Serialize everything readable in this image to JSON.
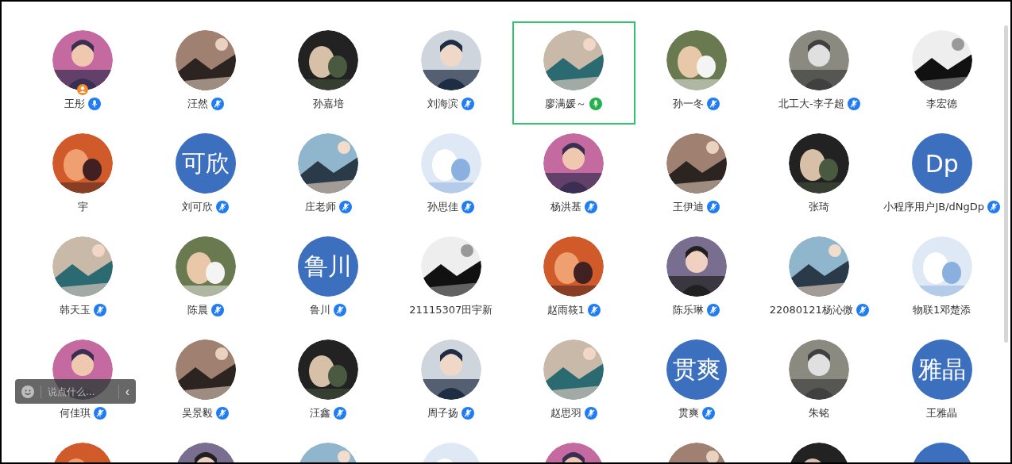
{
  "people": [
    {
      "name": "王彤",
      "avatar": {
        "kind": "picture"
      },
      "mic": {
        "muted": false,
        "speaking": false
      },
      "host": true,
      "selected": false
    },
    {
      "name": "汪然",
      "avatar": {
        "kind": "picture"
      },
      "mic": {
        "muted": true,
        "speaking": false
      },
      "host": false,
      "selected": false
    },
    {
      "name": "孙嘉培",
      "avatar": {
        "kind": "picture"
      },
      "host": false,
      "selected": false
    },
    {
      "name": "刘海滨",
      "avatar": {
        "kind": "picture"
      },
      "mic": {
        "muted": true,
        "speaking": false
      },
      "host": false,
      "selected": false
    },
    {
      "name": "廖满媛～",
      "avatar": {
        "kind": "picture"
      },
      "mic": {
        "muted": false,
        "speaking": true
      },
      "host": false,
      "selected": true
    },
    {
      "name": "孙一冬",
      "avatar": {
        "kind": "picture"
      },
      "mic": {
        "muted": true,
        "speaking": false
      },
      "host": false,
      "selected": false
    },
    {
      "name": "北工大-李子超",
      "avatar": {
        "kind": "picture"
      },
      "mic": {
        "muted": true,
        "speaking": false
      },
      "host": false,
      "selected": false
    },
    {
      "name": "李宏德",
      "avatar": {
        "kind": "picture"
      },
      "host": false,
      "selected": false
    },
    {
      "name": "宇",
      "avatar": {
        "kind": "picture"
      },
      "host": false,
      "selected": false
    },
    {
      "name": "刘可欣",
      "avatar": {
        "kind": "text",
        "text": "可欣"
      },
      "mic": {
        "muted": true,
        "speaking": false
      },
      "host": false,
      "selected": false
    },
    {
      "name": "庄老师",
      "avatar": {
        "kind": "picture"
      },
      "mic": {
        "muted": true,
        "speaking": false
      },
      "host": false,
      "selected": false
    },
    {
      "name": "孙思佳",
      "avatar": {
        "kind": "picture"
      },
      "mic": {
        "muted": true,
        "speaking": false
      },
      "host": false,
      "selected": false
    },
    {
      "name": "杨洪基",
      "avatar": {
        "kind": "picture"
      },
      "mic": {
        "muted": true,
        "speaking": false
      },
      "host": false,
      "selected": false
    },
    {
      "name": "王伊迪",
      "avatar": {
        "kind": "picture"
      },
      "mic": {
        "muted": true,
        "speaking": false
      },
      "host": false,
      "selected": false
    },
    {
      "name": "张琦",
      "avatar": {
        "kind": "picture"
      },
      "host": false,
      "selected": false
    },
    {
      "name": "小程序用户JB/dNgDp",
      "avatar": {
        "kind": "text",
        "text": "Dp"
      },
      "mic": {
        "muted": true,
        "speaking": false
      },
      "host": false,
      "selected": false
    },
    {
      "name": "韩天玉",
      "avatar": {
        "kind": "picture"
      },
      "mic": {
        "muted": true,
        "speaking": false
      },
      "host": false,
      "selected": false
    },
    {
      "name": "陈晨",
      "avatar": {
        "kind": "picture"
      },
      "mic": {
        "muted": true,
        "speaking": false
      },
      "host": false,
      "selected": false
    },
    {
      "name": "鲁川",
      "avatar": {
        "kind": "text",
        "text": "鲁川"
      },
      "mic": {
        "muted": true,
        "speaking": false
      },
      "host": false,
      "selected": false
    },
    {
      "name": "21115307田宇新",
      "avatar": {
        "kind": "picture"
      },
      "host": false,
      "selected": false
    },
    {
      "name": "赵雨筱1",
      "avatar": {
        "kind": "picture"
      },
      "mic": {
        "muted": true,
        "speaking": false
      },
      "host": false,
      "selected": false
    },
    {
      "name": "陈乐琳",
      "avatar": {
        "kind": "picture"
      },
      "mic": {
        "muted": true,
        "speaking": false
      },
      "host": false,
      "selected": false
    },
    {
      "name": "22080121杨沁微",
      "avatar": {
        "kind": "picture"
      },
      "mic": {
        "muted": true,
        "speaking": false
      },
      "host": false,
      "selected": false
    },
    {
      "name": "物联1邓楚添",
      "avatar": {
        "kind": "picture"
      },
      "host": false,
      "selected": false
    },
    {
      "name": "何佳琪",
      "avatar": {
        "kind": "picture"
      },
      "mic": {
        "muted": true,
        "speaking": false
      },
      "host": false,
      "selected": false
    },
    {
      "name": "吴景毅",
      "avatar": {
        "kind": "picture"
      },
      "mic": {
        "muted": true,
        "speaking": false
      },
      "host": false,
      "selected": false
    },
    {
      "name": "汪鑫",
      "avatar": {
        "kind": "picture"
      },
      "mic": {
        "muted": true,
        "speaking": false
      },
      "host": false,
      "selected": false
    },
    {
      "name": "周子扬",
      "avatar": {
        "kind": "picture"
      },
      "mic": {
        "muted": true,
        "speaking": false
      },
      "host": false,
      "selected": false
    },
    {
      "name": "赵思羽",
      "avatar": {
        "kind": "picture"
      },
      "mic": {
        "muted": true,
        "speaking": false
      },
      "host": false,
      "selected": false
    },
    {
      "name": "贯爽",
      "avatar": {
        "kind": "text",
        "text": "贯爽"
      },
      "mic": {
        "muted": true,
        "speaking": false
      },
      "host": false,
      "selected": false
    },
    {
      "name": "朱铭",
      "avatar": {
        "kind": "picture"
      },
      "host": false,
      "selected": false
    },
    {
      "name": "王雅晶",
      "avatar": {
        "kind": "text",
        "text": "雅晶"
      },
      "host": false,
      "selected": false
    },
    {
      "avatar": {
        "kind": "picture"
      }
    },
    {
      "avatar": {
        "kind": "picture"
      }
    },
    {
      "avatar": {
        "kind": "picture"
      }
    },
    {
      "avatar": {
        "kind": "picture"
      }
    },
    {
      "avatar": {
        "kind": "picture"
      }
    },
    {
      "avatar": {
        "kind": "picture"
      }
    },
    {
      "avatar": {
        "kind": "picture"
      }
    },
    {
      "avatar": {
        "kind": "plain"
      }
    }
  ],
  "chat_bar": {
    "placeholder": "说点什么...",
    "collapse": "‹"
  }
}
